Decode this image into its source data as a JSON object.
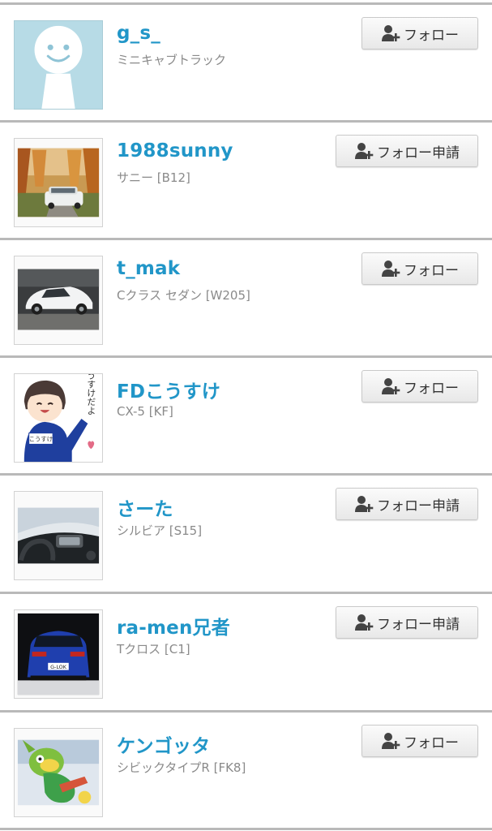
{
  "users": [
    {
      "name": "g_s_",
      "car": "ミニキャブトラック",
      "button": "フォロー",
      "avatar": "default-face"
    },
    {
      "name": "1988sunny",
      "car": "サニー [B12]",
      "button": "フォロー申請",
      "avatar": "car-autumn-road"
    },
    {
      "name": "t_mak",
      "car": "Cクラス セダン [W205]",
      "button": "フォロー",
      "avatar": "white-sedan"
    },
    {
      "name": "FDこうすけ",
      "car": "CX-5 [KF]",
      "button": "フォロー",
      "avatar": "cartoon-boy"
    },
    {
      "name": "さーた",
      "car": "シルビア [S15]",
      "button": "フォロー申請",
      "avatar": "car-dashboard"
    },
    {
      "name": "ra-men兄者",
      "car": "Tクロス [C1]",
      "button": "フォロー申請",
      "avatar": "blue-hatchback-rear"
    },
    {
      "name": "ケンゴッタ",
      "car": "シビックタイプR [FK8]",
      "button": "フォロー",
      "avatar": "green-plush-toy"
    }
  ],
  "colors": {
    "name": "#2196c8",
    "subtext": "#8a8a8a",
    "separator": "#b9b9b9"
  },
  "avatar_text": {
    "u3": "こうすけだよ",
    "u3_badge": "こうすけ",
    "u5_plate": "G-LOK"
  }
}
